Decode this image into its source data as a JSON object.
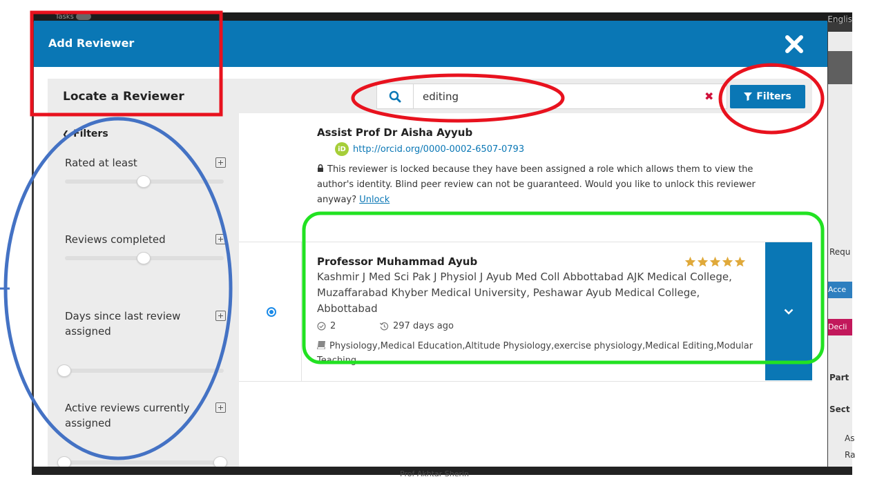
{
  "background": {
    "tasks_label": "Tasks",
    "language_label": "Englis",
    "right_panel": [
      "Requ",
      "Acce",
      "Decli",
      "Part",
      "Sect",
      "As",
      "Ra"
    ]
  },
  "caption": "Prof Akhtar Sherin",
  "modal": {
    "title": "Add Reviewer",
    "locate_title": "Locate a Reviewer",
    "search": {
      "value": "editing",
      "clear_label": "✖"
    },
    "filters_button": "Filters",
    "sidebar": {
      "title": "Filters",
      "filters": [
        {
          "label": "Rated at least"
        },
        {
          "label": "Reviews completed"
        },
        {
          "label": "Days since last review assigned"
        },
        {
          "label": "Active reviews currently assigned"
        }
      ]
    },
    "reviewers": [
      {
        "name": "Assist Prof Dr Aisha Ayyub",
        "orcid_label": "iD",
        "orcid": "http://orcid.org/0000-0002-6507-0793",
        "locked_message": "This reviewer is locked because they have been assigned a role which allows them to view the author's identity. Blind peer review can not be guaranteed. Would you like to unlock this reviewer anyway?",
        "unlock_label": "Unlock"
      },
      {
        "name": "Professor Muhammad Ayub",
        "rating": 5,
        "affiliation": "Kashmir J Med Sci Pak J Physiol J Ayub Med Coll Abbottabad AJK Medical College, Muzaffarabad Khyber Medical University, Peshawar Ayub Medical College, Abbottabad",
        "reviews_completed": "2",
        "last_review": "297 days ago",
        "interests": "Physiology,Medical Education,Altitude Physiology,exercise physiology,Medical Editing,Modular Teaching"
      }
    ]
  },
  "colors": {
    "primary": "#0a77b5",
    "star": "#e0a93a",
    "annotation_red": "#e8121e",
    "annotation_blue": "#4472c4",
    "annotation_green": "#22e222",
    "orcid_green": "#a6ce39",
    "clear_red": "#d0103a"
  },
  "icons": {
    "close": "close-icon",
    "search": "search-icon",
    "filter": "filter-funnel-icon",
    "plus": "plus-square-icon",
    "lock": "lock-icon",
    "star": "star-icon",
    "check": "check-circle-icon",
    "history": "history-icon",
    "book": "book-icon",
    "chevron": "chevron-down-icon",
    "orcid": "orcid-icon"
  }
}
